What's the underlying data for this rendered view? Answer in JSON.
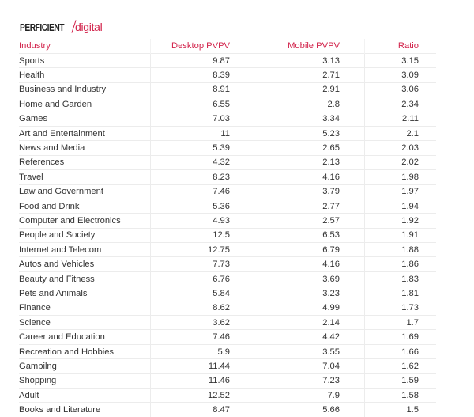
{
  "logo": {
    "text_main": "PERFICIENT",
    "text_accent": "digital"
  },
  "colors": {
    "accent": "#d2234b",
    "text": "#333333",
    "grid": "#ececec"
  },
  "chart_data": {
    "type": "table",
    "columns": [
      "Industry",
      "Desktop PVPV",
      "Mobile PVPV",
      "Ratio"
    ],
    "rows": [
      [
        "Sports",
        "9.87",
        "3.13",
        "3.15"
      ],
      [
        "Health",
        "8.39",
        "2.71",
        "3.09"
      ],
      [
        "Business and Industry",
        "8.91",
        "2.91",
        "3.06"
      ],
      [
        "Home and Garden",
        "6.55",
        "2.8",
        "2.34"
      ],
      [
        "Games",
        "7.03",
        "3.34",
        "2.11"
      ],
      [
        "Art and Entertainment",
        "11",
        "5.23",
        "2.1"
      ],
      [
        "News and Media",
        "5.39",
        "2.65",
        "2.03"
      ],
      [
        "References",
        "4.32",
        "2.13",
        "2.02"
      ],
      [
        "Travel",
        "8.23",
        "4.16",
        "1.98"
      ],
      [
        "Law and Government",
        "7.46",
        "3.79",
        "1.97"
      ],
      [
        "Food and Drink",
        "5.36",
        "2.77",
        "1.94"
      ],
      [
        "Computer and Electronics",
        "4.93",
        "2.57",
        "1.92"
      ],
      [
        "People and Society",
        "12.5",
        "6.53",
        "1.91"
      ],
      [
        "Internet and Telecom",
        "12.75",
        "6.79",
        "1.88"
      ],
      [
        "Autos and Vehicles",
        "7.73",
        "4.16",
        "1.86"
      ],
      [
        "Beauty and Fitness",
        "6.76",
        "3.69",
        "1.83"
      ],
      [
        "Pets and Animals",
        "5.84",
        "3.23",
        "1.81"
      ],
      [
        "Finance",
        "8.62",
        "4.99",
        "1.73"
      ],
      [
        "Science",
        "3.62",
        "2.14",
        "1.7"
      ],
      [
        "Career and Education",
        "7.46",
        "4.42",
        "1.69"
      ],
      [
        "Recreation and Hobbies",
        "5.9",
        "3.55",
        "1.66"
      ],
      [
        "Gambilng",
        "11.44",
        "7.04",
        "1.62"
      ],
      [
        "Shopping",
        "11.46",
        "7.23",
        "1.59"
      ],
      [
        "Adult",
        "12.52",
        "7.9",
        "1.58"
      ],
      [
        "Books and Literature",
        "8.47",
        "5.66",
        "1.5"
      ]
    ]
  }
}
